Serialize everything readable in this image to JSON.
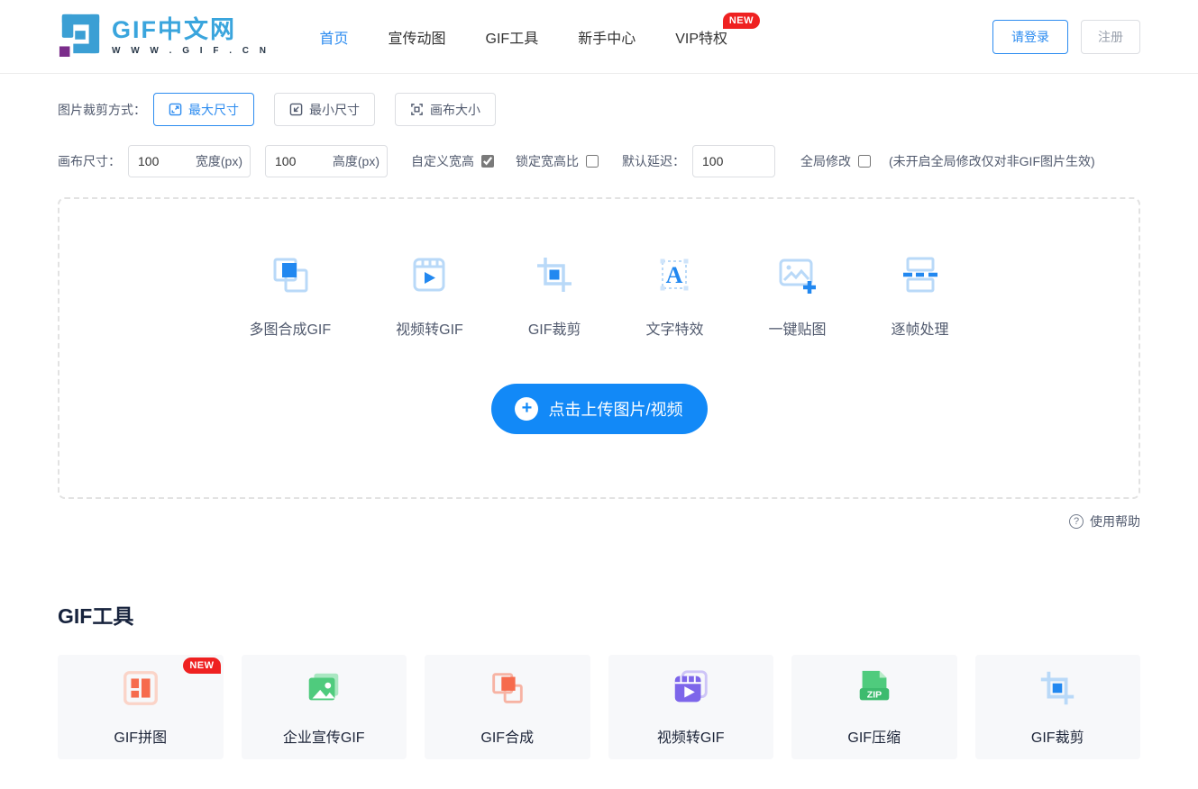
{
  "colors": {
    "accent": "#2d8cf0",
    "upload_blue": "#1289f7",
    "badge_red": "#ef2121",
    "icon_light_blue": "#b9d9f8",
    "icon_solid_blue": "#2288f0",
    "orange": "#f66b4d",
    "green": "#4fcb7d",
    "purple": "#7d66ea"
  },
  "header": {
    "logo": {
      "title": "GIF中文网",
      "subtitle": "W W W . G I F .   C N"
    },
    "nav": [
      {
        "label": "首页",
        "active": true
      },
      {
        "label": "宣传动图",
        "active": false
      },
      {
        "label": "GIF工具",
        "active": false
      },
      {
        "label": "新手中心",
        "active": false
      },
      {
        "label": "VIP特权",
        "active": false,
        "badge": "NEW"
      }
    ],
    "login_label": "请登录",
    "register_label": "注册"
  },
  "crop_mode": {
    "label": "图片裁剪方式：",
    "options": [
      {
        "label": "最大尺寸",
        "icon": "expand-icon",
        "active": true
      },
      {
        "label": "最小尺寸",
        "icon": "shrink-icon",
        "active": false
      },
      {
        "label": "画布大小",
        "icon": "canvas-icon",
        "active": false
      }
    ]
  },
  "canvas_settings": {
    "label": "画布尺寸：",
    "width": {
      "value": "100",
      "unit": "宽度(px)"
    },
    "height": {
      "value": "100",
      "unit": "高度(px)"
    },
    "custom_wh": {
      "label": "自定义宽高",
      "checked": true
    },
    "lock_ratio": {
      "label": "锁定宽高比",
      "checked": false
    },
    "delay": {
      "label": "默认延迟：",
      "value": "100"
    },
    "global_edit": {
      "label": "全局修改",
      "checked": false
    },
    "global_note": "(未开启全局修改仅对非GIF图片生效)"
  },
  "upload": {
    "features": [
      {
        "label": "多图合成GIF",
        "icon": "layers-icon"
      },
      {
        "label": "视频转GIF",
        "icon": "film-play-icon"
      },
      {
        "label": "GIF裁剪",
        "icon": "crop-icon"
      },
      {
        "label": "文字特效",
        "icon": "text-effect-icon"
      },
      {
        "label": "一键贴图",
        "icon": "image-plus-icon"
      },
      {
        "label": "逐帧处理",
        "icon": "frames-icon"
      }
    ],
    "button_label": "点击上传图片/视频"
  },
  "help": {
    "label": "使用帮助"
  },
  "tools_section": {
    "title": "GIF工具",
    "cards": [
      {
        "label": "GIF拼图",
        "icon": "collage-icon",
        "badge": "NEW"
      },
      {
        "label": "企业宣传GIF",
        "icon": "photo-stack-icon"
      },
      {
        "label": "GIF合成",
        "icon": "merge-icon"
      },
      {
        "label": "视频转GIF",
        "icon": "video-icon"
      },
      {
        "label": "GIF压缩",
        "icon": "zip-icon"
      },
      {
        "label": "GIF裁剪",
        "icon": "crop-blue-icon"
      }
    ]
  }
}
